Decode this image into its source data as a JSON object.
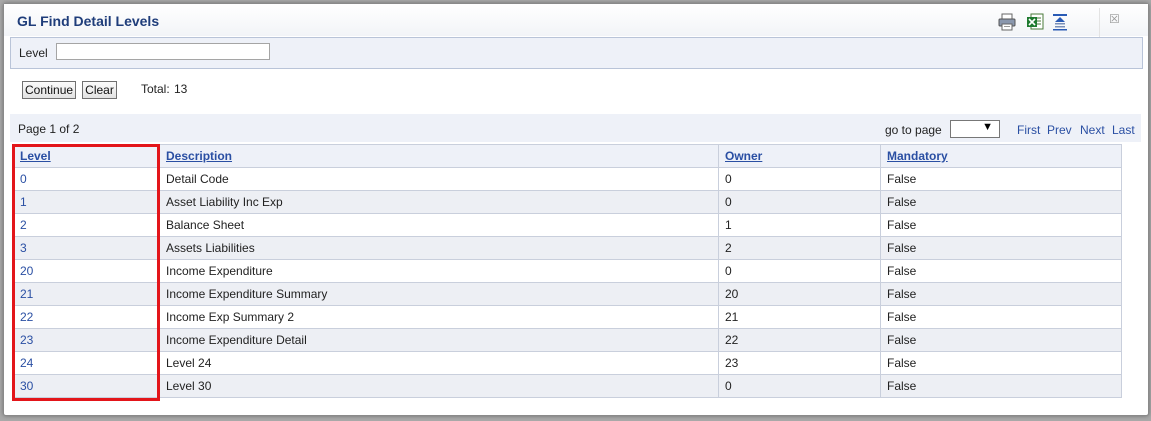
{
  "dialog": {
    "title": "GL Find Detail Levels",
    "toolbar_icons": [
      "printer-icon",
      "excel-export-icon",
      "collapse-icon"
    ],
    "close_glyph": "☒"
  },
  "search": {
    "label": "Level",
    "value": "",
    "placeholder": ""
  },
  "actions": {
    "continue_label": "Continue",
    "clear_label": "Clear",
    "total_label": "Total:",
    "total_value": "13"
  },
  "pager": {
    "page_info": "Page 1 of 2",
    "goto_label": "go to page",
    "goto_value": "",
    "first": "First",
    "prev": "Prev",
    "next": "Next",
    "last": "Last"
  },
  "table": {
    "columns": [
      "Level",
      "Description",
      "Owner",
      "Mandatory"
    ],
    "rows": [
      [
        "0",
        "Detail Code",
        "0",
        "False"
      ],
      [
        "1",
        "Asset Liability Inc Exp",
        "0",
        "False"
      ],
      [
        "2",
        "Balance Sheet",
        "1",
        "False"
      ],
      [
        "3",
        "Assets Liabilities",
        "2",
        "False"
      ],
      [
        "20",
        "Income Expenditure",
        "0",
        "False"
      ],
      [
        "21",
        "Income Expenditure Summary",
        "20",
        "False"
      ],
      [
        "22",
        "Income Exp Summary 2",
        "21",
        "False"
      ],
      [
        "23",
        "Income Expenditure Detail",
        "22",
        "False"
      ],
      [
        "24",
        "Level 24",
        "23",
        "False"
      ],
      [
        "30",
        "Level 30",
        "0",
        "False"
      ]
    ]
  },
  "colors": {
    "title": "#1f3d7a",
    "link": "#2a4fa3",
    "highlight": "#e3151a",
    "band": "#eef1f8"
  }
}
